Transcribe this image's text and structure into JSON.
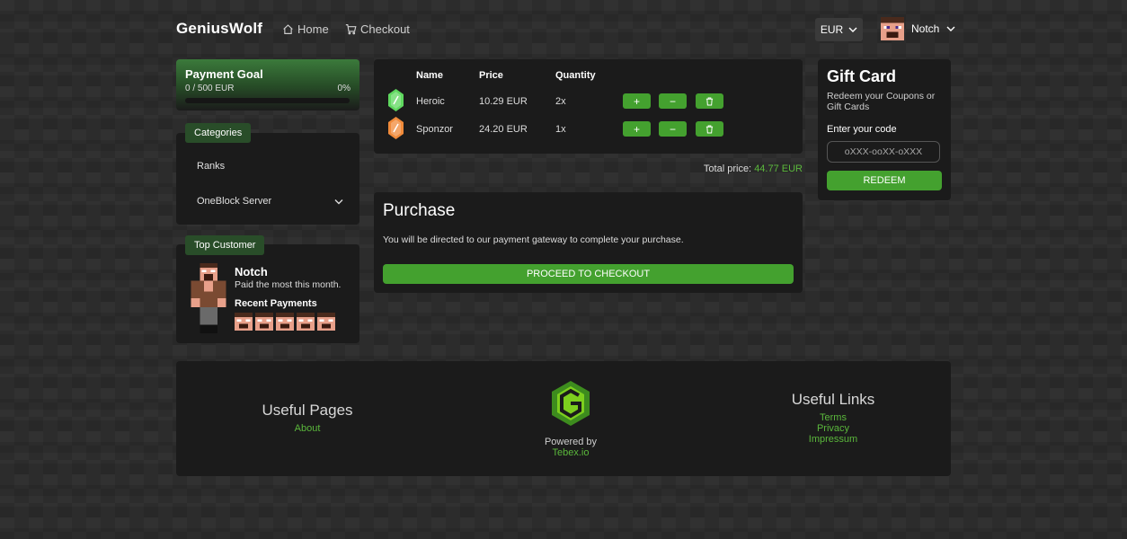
{
  "header": {
    "logo": "GeniusWolf",
    "nav": [
      {
        "label": "Home",
        "icon": "home-icon"
      },
      {
        "label": "Checkout",
        "icon": "cart-icon"
      }
    ],
    "currency": "EUR",
    "user": "Notch"
  },
  "payment_goal": {
    "title": "Payment Goal",
    "amount": "0 / 500 EUR",
    "percent_label": "0%",
    "progress": 0
  },
  "categories": {
    "title": "Categories",
    "items": [
      {
        "label": "Ranks"
      },
      {
        "label": "OneBlock Server",
        "has_dropdown": true
      }
    ]
  },
  "top_customer": {
    "title": "Top Customer",
    "name": "Notch",
    "subtitle": "Paid the most this month.",
    "recent_label": "Recent Payments",
    "recent_count": 5
  },
  "cart": {
    "headers": {
      "name": "Name",
      "price": "Price",
      "quantity": "Quantity"
    },
    "items": [
      {
        "name": "Heroic",
        "price": "10.29 EUR",
        "quantity": "2x",
        "gem_color": "#5fd85f"
      },
      {
        "name": "Sponzor",
        "price": "24.20 EUR",
        "quantity": "1x",
        "gem_color": "#f08a3a"
      }
    ],
    "buttons": {
      "plus": "+",
      "minus": "−"
    },
    "total_label": "Total price:",
    "total_value": "44.77 EUR"
  },
  "purchase": {
    "title": "Purchase",
    "text": "You will be directed to our payment gateway to complete your purchase.",
    "button": "PROCEED TO CHECKOUT"
  },
  "gift_card": {
    "title": "Gift Card",
    "subtitle": "Redeem your Coupons or Gift Cards",
    "label": "Enter your code",
    "placeholder": "oXXX-ooXX-oXXX",
    "button": "REDEEM"
  },
  "footer": {
    "useful_pages": {
      "title": "Useful Pages",
      "links": [
        "About"
      ]
    },
    "powered_by": "Powered by",
    "powered_link": "Tebex.io",
    "useful_links": {
      "title": "Useful Links",
      "links": [
        "Terms",
        "Privacy",
        "Impressum"
      ]
    }
  },
  "colors": {
    "accent": "#44a12f",
    "accent_text": "#5bb83c",
    "panel": "#1b1b1b"
  }
}
